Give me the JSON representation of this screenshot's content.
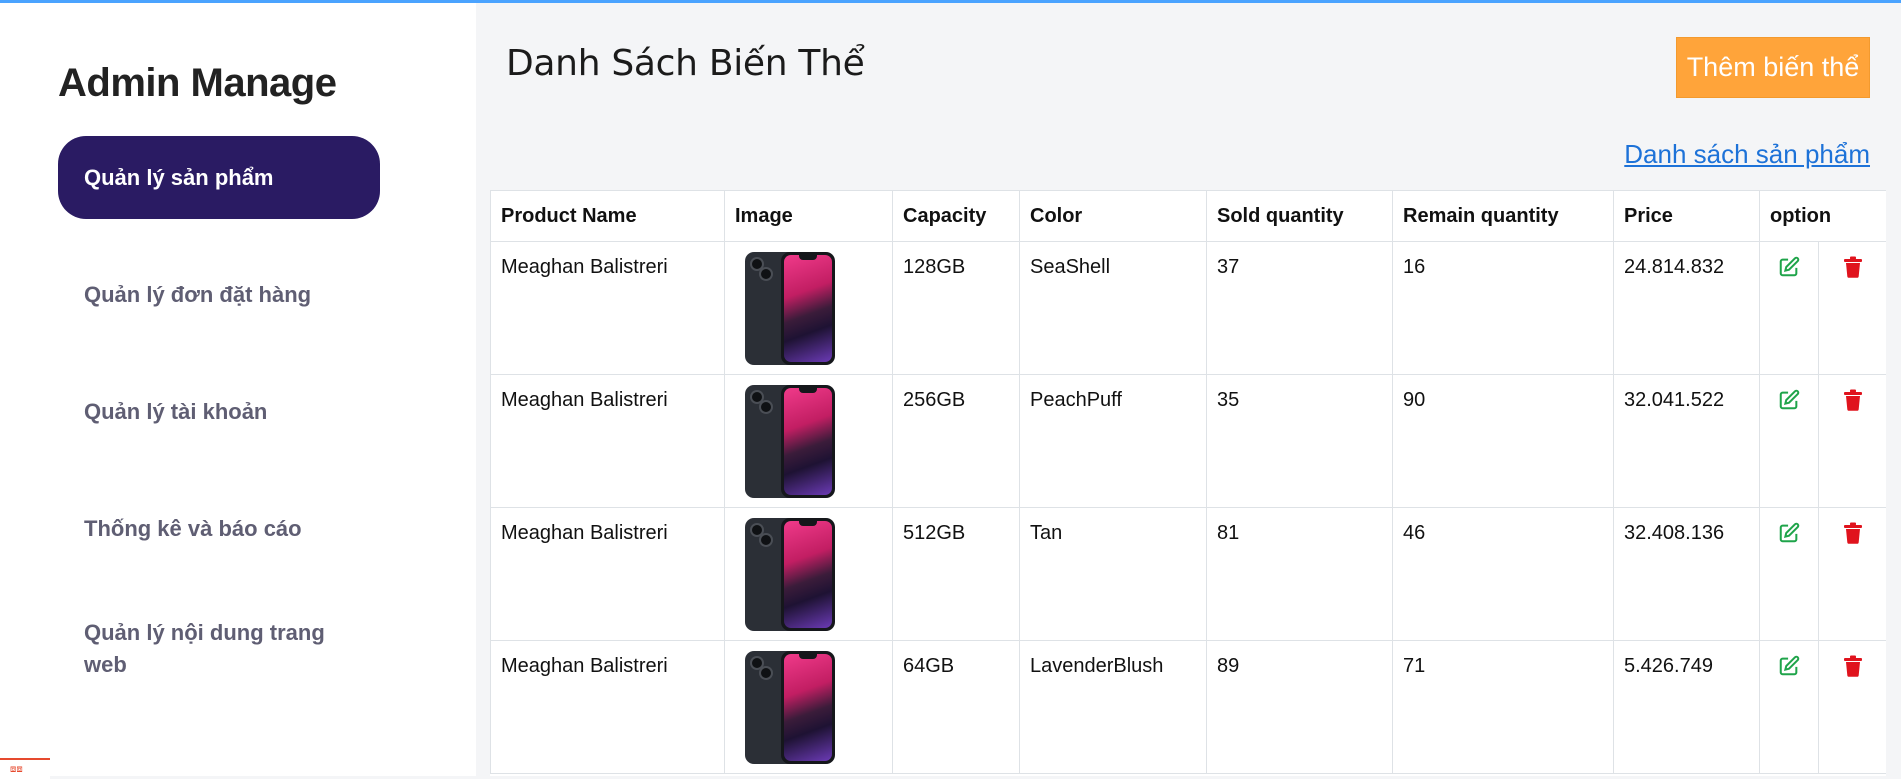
{
  "sidebar": {
    "brand": "Admin Manage",
    "items": [
      {
        "label": "Quản lý sản phẩm",
        "active": true
      },
      {
        "label": "Quản lý đơn đặt hàng",
        "active": false
      },
      {
        "label": "Quản lý tài khoản",
        "active": false
      },
      {
        "label": "Thống kê và báo cáo",
        "active": false
      },
      {
        "label": "Quản lý nội dung trang web",
        "active": false
      }
    ]
  },
  "header": {
    "title": "Danh Sách Biến Thể",
    "add_button": "Thêm biến thể",
    "product_list_link": "Danh sách sản phẩm"
  },
  "table": {
    "columns": [
      "Product Name",
      "Image",
      "Capacity",
      "Color",
      "Sold quantity",
      "Remain quantity",
      "Price",
      "option"
    ],
    "rows": [
      {
        "product_name": "Meaghan Balistreri",
        "capacity": "128GB",
        "color": "SeaShell",
        "sold": "37",
        "remain": "16",
        "price": "24.814.832"
      },
      {
        "product_name": "Meaghan Balistreri",
        "capacity": "256GB",
        "color": "PeachPuff",
        "sold": "35",
        "remain": "90",
        "price": "32.041.522"
      },
      {
        "product_name": "Meaghan Balistreri",
        "capacity": "512GB",
        "color": "Tan",
        "sold": "81",
        "remain": "46",
        "price": "32.408.136"
      },
      {
        "product_name": "Meaghan Balistreri",
        "capacity": "64GB",
        "color": "LavenderBlush",
        "sold": "89",
        "remain": "71",
        "price": "5.426.749"
      }
    ]
  },
  "icons": {
    "edit": "edit-icon",
    "delete": "trash-icon",
    "image": "phone-image"
  },
  "colors": {
    "accent_nav": "#2a1b63",
    "add_button": "#ffa43a",
    "link": "#1d72d8",
    "edit_icon": "#1fa44a",
    "delete_icon": "#e0131d",
    "top_line": "#4aa3ff"
  }
}
